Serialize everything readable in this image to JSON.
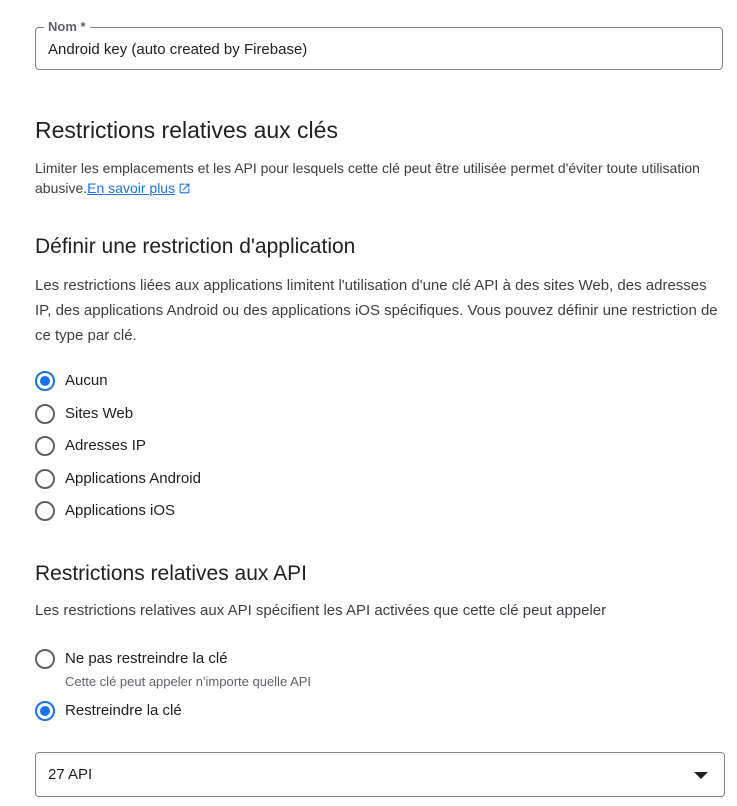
{
  "name_field": {
    "label": "Nom *",
    "value": "Android key (auto created by Firebase)"
  },
  "key_restrictions": {
    "title": "Restrictions relatives aux clés",
    "description": "Limiter les emplacements et les API pour lesquels cette clé peut être utilisée permet d'éviter toute utilisation abusive.",
    "learn_more": "En savoir plus",
    "learn_more_icon": "open-in-new-icon"
  },
  "app_restriction": {
    "title": "Définir une restriction d'application",
    "description": "Les restrictions liées aux applications limitent l'utilisation d'une clé API à des sites Web, des adresses IP, des applications Android ou des applications iOS spécifiques. Vous pouvez définir une restriction de ce type par clé.",
    "options": [
      {
        "label": "Aucun",
        "checked": true
      },
      {
        "label": "Sites Web",
        "checked": false
      },
      {
        "label": "Adresses IP",
        "checked": false
      },
      {
        "label": "Applications Android",
        "checked": false
      },
      {
        "label": "Applications iOS",
        "checked": false
      }
    ]
  },
  "api_restrictions": {
    "title": "Restrictions relatives aux API",
    "description": "Les restrictions relatives aux API spécifient les API activées que cette clé peut appeler",
    "options": [
      {
        "label": "Ne pas restreindre la clé",
        "checked": false,
        "help": "Cette clé peut appeler n'importe quelle API"
      },
      {
        "label": "Restreindre la clé",
        "checked": true
      }
    ],
    "select_value": "27 API"
  },
  "colors": {
    "accent": "#1a73e8",
    "text": "#202124",
    "muted": "#5f6368",
    "border": "#80868b"
  }
}
